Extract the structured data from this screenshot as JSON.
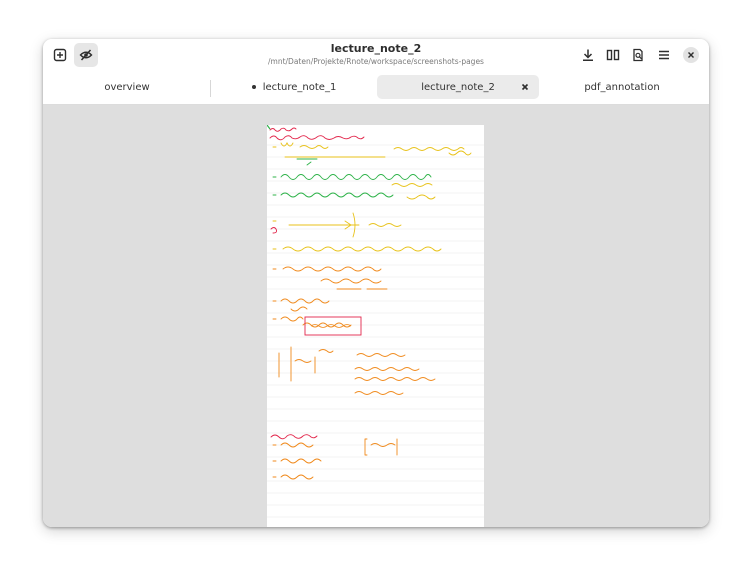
{
  "header": {
    "title": "lecture_note_2",
    "subtitle": "/mnt/Daten/Projekte/Rnote/workspace/screenshots-pages",
    "left_buttons": [
      {
        "name": "new-tab-icon"
      },
      {
        "name": "visibility-off-icon"
      }
    ],
    "right_buttons": [
      {
        "name": "download-icon"
      },
      {
        "name": "columns-icon"
      },
      {
        "name": "search-document-icon"
      },
      {
        "name": "menu-icon"
      }
    ],
    "close_icon": "close-icon"
  },
  "tabs": [
    {
      "label": "overview",
      "active": false,
      "modified": false
    },
    {
      "label": "lecture_note_1",
      "active": false,
      "modified": true
    },
    {
      "label": "lecture_note_2",
      "active": true,
      "modified": false
    },
    {
      "label": "pdf_annotation",
      "active": false,
      "modified": false
    }
  ],
  "colors": {
    "content_background": "#dedede",
    "ink_red": "#e2264b",
    "ink_green": "#2fb34a",
    "ink_yellow": "#e8c21a",
    "ink_orange": "#f08a1c"
  }
}
